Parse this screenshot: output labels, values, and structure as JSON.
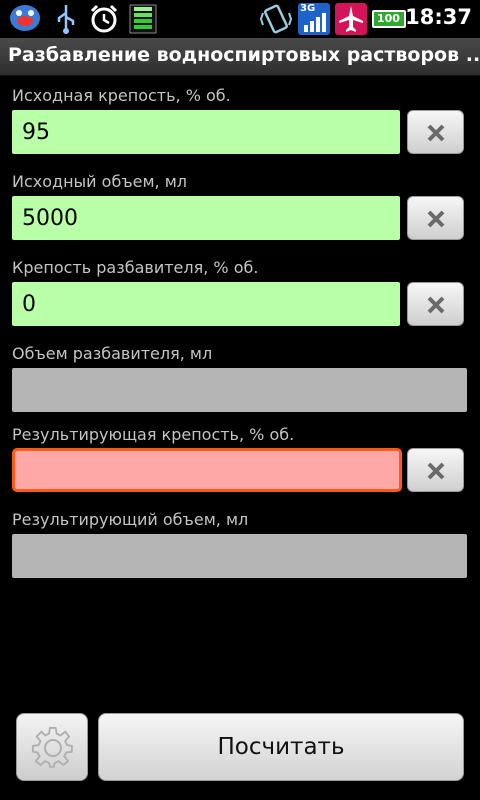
{
  "status_bar": {
    "time": "18:37",
    "network_badge": "3G",
    "battery_level": "100",
    "icons": [
      "talk-icon",
      "usb-icon",
      "alarm-icon",
      "signal-meter-icon",
      "vibrate-icon",
      "network-signal-icon",
      "airplane-mode-icon",
      "battery-icon"
    ]
  },
  "app": {
    "title": "Разбавление водноспиртовых растворов ..."
  },
  "fields": [
    {
      "label": "Исходная крепость, % об.",
      "value": "95",
      "state": "input"
    },
    {
      "label": "Исходный объем, мл",
      "value": "5000",
      "state": "input"
    },
    {
      "label": "Крепость разбавителя, % об.",
      "value": "0",
      "state": "input"
    },
    {
      "label": "Объем разбавителя, мл",
      "value": "",
      "state": "disabled"
    },
    {
      "label": "Результирующая крепость, % об.",
      "value": "",
      "state": "error"
    },
    {
      "label": "Результирующий объем, мл",
      "value": "",
      "state": "disabled"
    }
  ],
  "buttons": {
    "calculate": "Посчитать",
    "settings_icon": "gear-icon",
    "clear_icon": "close-icon"
  },
  "colors": {
    "input_bg": "#b8ffa8",
    "disabled_bg": "#b5b5b5",
    "error_bg": "#ffa8a8",
    "error_border": "#ff5a14",
    "title_bg": "#3c3c3c"
  }
}
